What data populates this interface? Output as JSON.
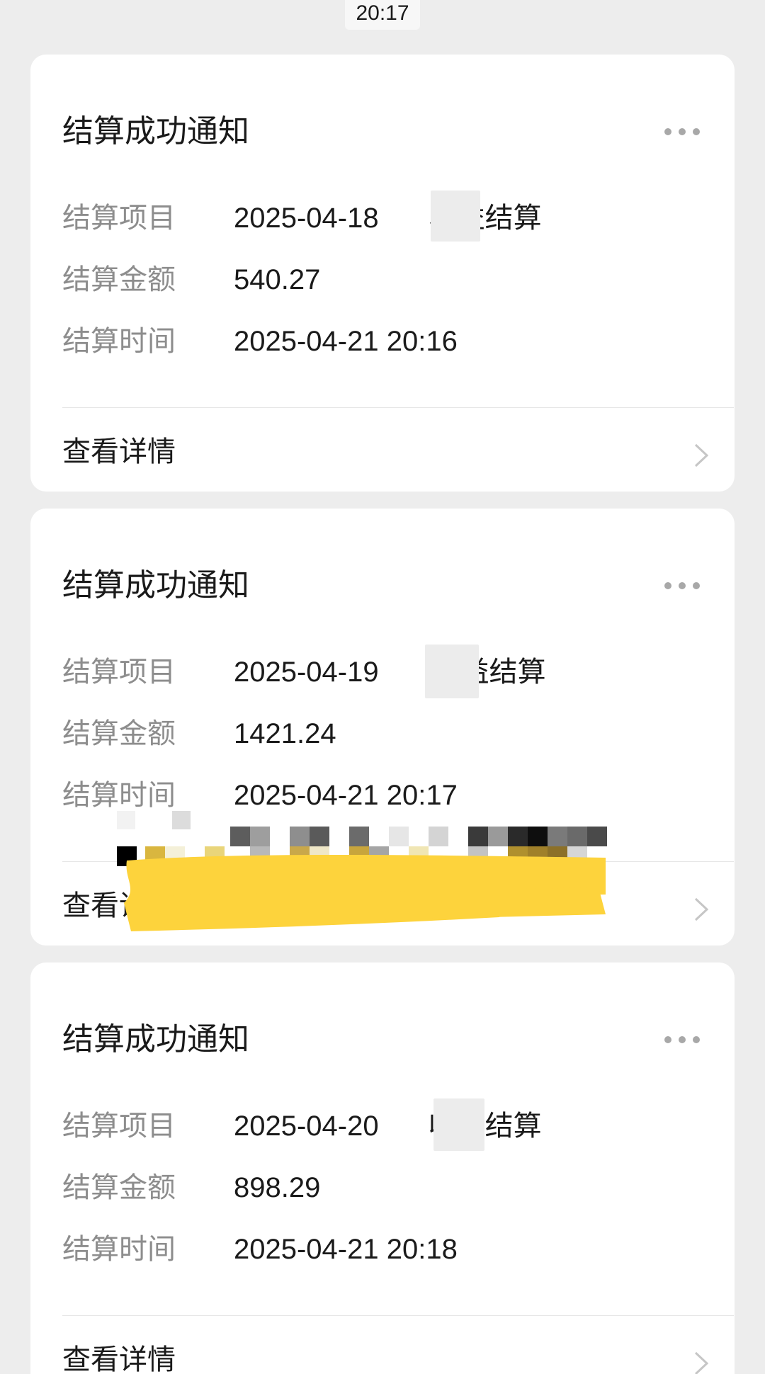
{
  "status_time": "20:17",
  "colors": {
    "background": "#ededed",
    "card": "#ffffff",
    "label": "#8d8d8d",
    "text": "#1a1a1a",
    "redaction": "#fdd33c"
  },
  "cards": [
    {
      "title": "结算成功通知",
      "project_label": "结算项目",
      "project_value_prefix": "2025-04-18",
      "project_value_suffix": "收益结算",
      "amount_label": "结算金额",
      "amount_value": "540.27",
      "time_label": "结算时间",
      "time_value": "2025-04-21 20:16",
      "detail_label": "查看详情",
      "more_icon": "more-dots-icon",
      "chevron_icon": "chevron-right-icon"
    },
    {
      "title": "结算成功通知",
      "project_label": "结算项目",
      "project_value_prefix": "2025-04-19",
      "project_value_suffix": "收益结算",
      "amount_label": "结算金额",
      "amount_value": "1421.24",
      "time_label": "结算时间",
      "time_value": "2025-04-21 20:17",
      "detail_label": "查看详情",
      "more_icon": "more-dots-icon",
      "chevron_icon": "chevron-right-icon"
    },
    {
      "title": "结算成功通知",
      "project_label": "结算项目",
      "project_value_prefix": "2025-04-20",
      "project_value_suffix": "收益结算",
      "amount_label": "结算金额",
      "amount_value": "898.29",
      "time_label": "结算时间",
      "time_value": "2025-04-21 20:18",
      "detail_label": "查看详情",
      "more_icon": "more-dots-icon",
      "chevron_icon": "chevron-right-icon"
    }
  ]
}
